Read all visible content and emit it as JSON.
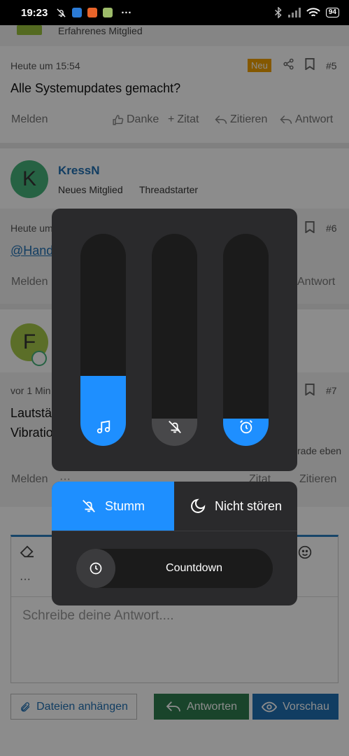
{
  "status_bar": {
    "time": "19:23",
    "more": "···",
    "battery": "94"
  },
  "forum": {
    "prev_user_role": "Erfahrenes Mitglied",
    "post5": {
      "timestamp": "Heute um 15:54",
      "badge": "Neu",
      "number": "#5",
      "text": "Alle Systemupdates gemacht?",
      "report": "Melden",
      "thanks": "Danke",
      "quote": "Zitat",
      "cite": "Zitieren",
      "reply": "Antwort"
    },
    "post6": {
      "avatar_letter": "K",
      "username": "KressN",
      "role": "Neues Mitglied",
      "thread_starter": "Threadstarter",
      "timestamp": "Heute um",
      "number": "#6",
      "mention": "@Hand",
      "report": "Melden",
      "reply": "Antwort"
    },
    "post7": {
      "avatar_letter": "F",
      "timestamp": "vor 1 Min",
      "number": "#7",
      "line1": "Lautstä",
      "line2": "Vibratio",
      "edited": "rade eben",
      "report": "Melden",
      "more": "···",
      "quote": "Zitat",
      "cite": "Zitieren"
    },
    "editor": {
      "placeholder": "Schreibe deine Antwort....",
      "more": "···"
    },
    "buttons": {
      "attach": "Dateien anhängen",
      "reply": "Antworten",
      "preview": "Vorschau"
    }
  },
  "volume_panel": {
    "sliders": [
      {
        "name": "media",
        "icon": "music-note-icon",
        "level": 0.33,
        "color": "#1e8fff"
      },
      {
        "name": "ring",
        "icon": "bell-off-icon",
        "level": 0.13,
        "color": "#48484a"
      },
      {
        "name": "alarm",
        "icon": "alarm-clock-icon",
        "level": 0.13,
        "color": "#1e8fff"
      }
    ]
  },
  "mode_panel": {
    "mute_label": "Stumm",
    "dnd_label": "Nicht stören",
    "countdown_label": "Countdown",
    "active_color": "#1e8fff"
  }
}
